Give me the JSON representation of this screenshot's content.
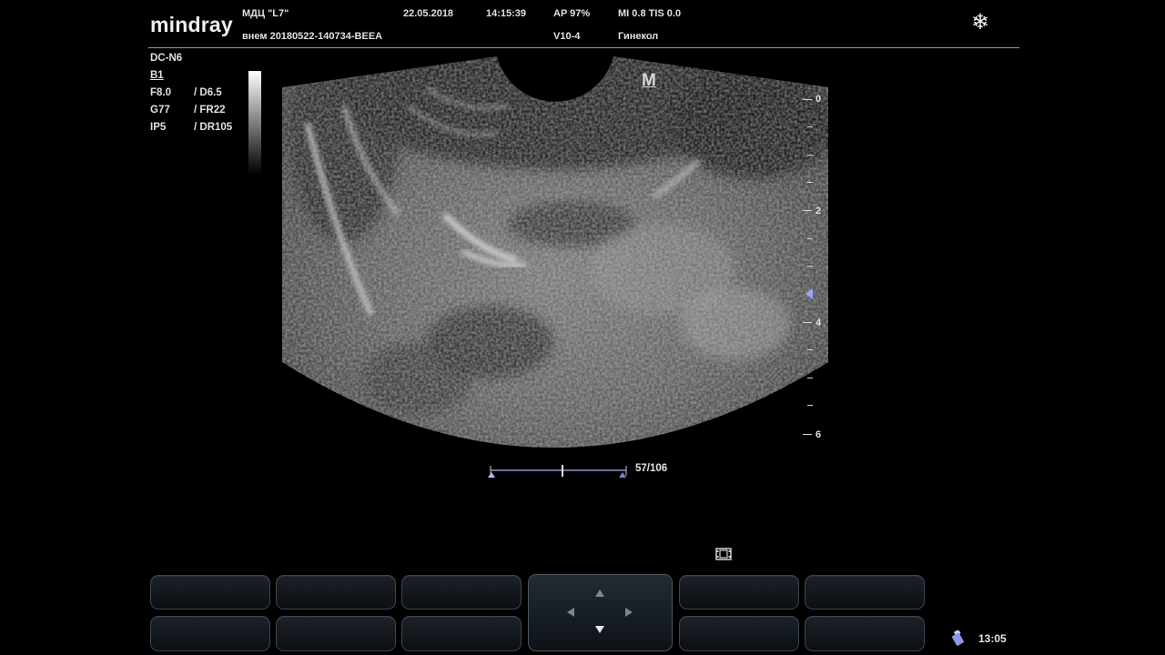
{
  "header": {
    "brand": "mindray",
    "clinic": "МДЦ \"L7\"",
    "patient_id": "внем 20180522-140734-BEEA",
    "date": "22.05.2018",
    "time": "14:15:39",
    "ap": "AP  97%",
    "mi_tis": "MI 0.8  TIS 0.0",
    "probe": "V10-4",
    "preset": "Гинекол",
    "freeze_icon": "snowflake-icon"
  },
  "params": {
    "model": "DC-N6",
    "mode": "B1",
    "freq": "F8.0",
    "depth": "/ D6.5",
    "gain": "G77",
    "frame_rate": "/ FR22",
    "image_process": "IP5",
    "dynamic_range": "/ DR105"
  },
  "image": {
    "marker": "M"
  },
  "depth_scale": {
    "labels": [
      "0",
      "2",
      "4",
      "6"
    ]
  },
  "cine": {
    "counter": "57/106",
    "current_frame": 57,
    "total_frames": 106
  },
  "status": {
    "clock": "13:05",
    "usb_icon": "usb-drive-icon",
    "film_icon": "film-clip-icon"
  },
  "softkeys": {
    "top_row": [
      "",
      "",
      "",
      "",
      ""
    ],
    "bottom_row": [
      "",
      "",
      "",
      "",
      ""
    ]
  },
  "colors": {
    "accent": "#9aa4ff",
    "panel": "#1b2229"
  }
}
